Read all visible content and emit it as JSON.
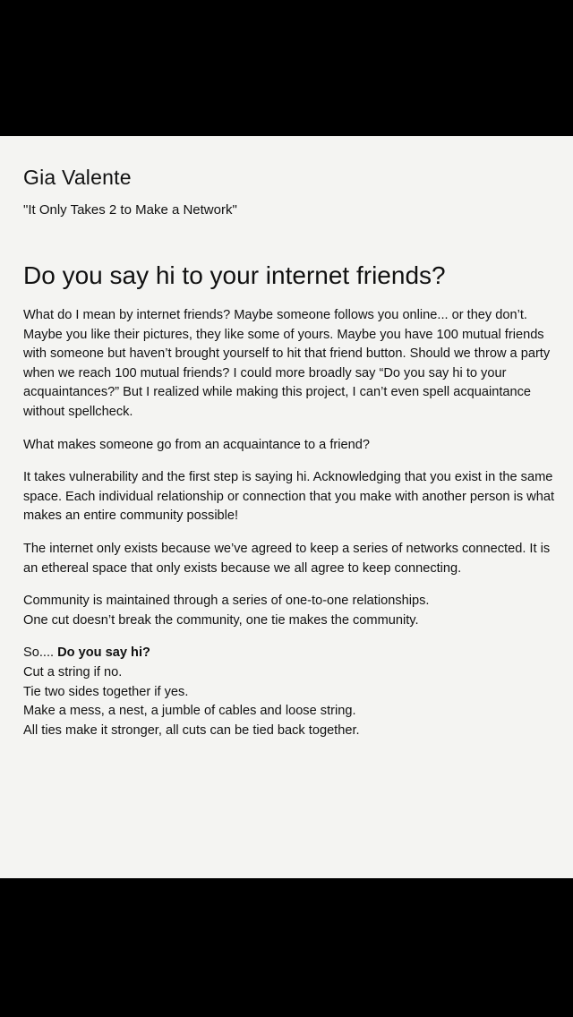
{
  "placard": {
    "artist": "Gia Valente",
    "work_title": "\"It Only Takes 2 to Make a Network\"",
    "headline": "Do you say hi to your internet friends?",
    "paragraphs": [
      "What do I mean by internet friends? Maybe someone follows you online... or they don’t. Maybe you like their pictures, they like some of yours. Maybe you have 100 mutual friends with someone but haven’t brought yourself to hit that friend button. Should we throw a party when we reach 100 mutual friends? I could more broadly say “Do you say hi to your acquaintances?” But I realized while making this project, I can’t even spell acquaintance without spellcheck.",
      "What makes someone go from an acquaintance to a friend?",
      "It takes vulnerability and the first step is saying hi. Acknowledging that you exist in the same space. Each individual relationship or connection that you make with another person is what makes an entire community possible!",
      "The internet only exists because we’ve agreed to keep a series of networks connected. It is an ethereal space that only exists because we all agree to keep connecting."
    ],
    "community_lines": [
      "Community is maintained through a series of one-to-one relationships.",
      "One cut doesn’t break the community, one tie makes the community."
    ],
    "closing": {
      "prefix": "So.... ",
      "question": "Do you say hi?",
      "lines": [
        "Cut a string if no.",
        "Tie two sides together if yes.",
        "Make a mess, a nest, a jumble of cables and loose string.",
        "All ties make it stronger, all cuts can be tied back together."
      ]
    }
  },
  "colors": {
    "background": "#000000",
    "paper": "#f4f4f2",
    "text": "#111111"
  }
}
